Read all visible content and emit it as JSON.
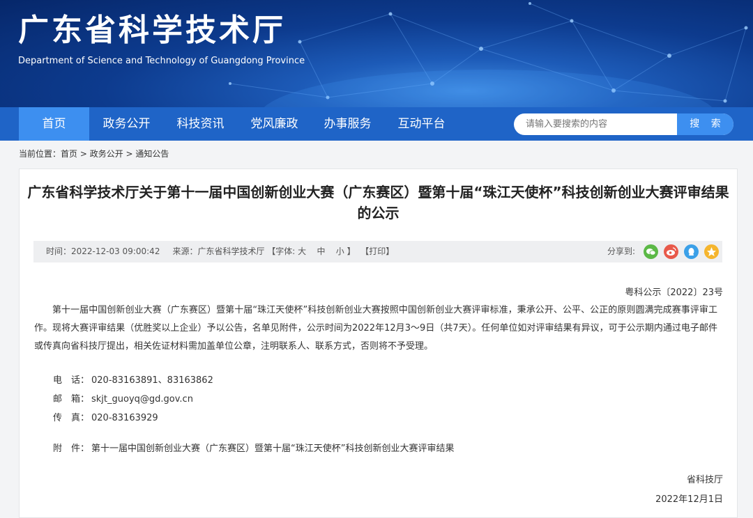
{
  "header": {
    "title": "广东省科学技术厅",
    "subtitle": "Department of Science and Technology of Guangdong Province"
  },
  "nav": {
    "items": [
      {
        "label": "首页",
        "active": true
      },
      {
        "label": "政务公开"
      },
      {
        "label": "科技资讯"
      },
      {
        "label": "党风廉政"
      },
      {
        "label": "办事服务"
      },
      {
        "label": "互动平台"
      }
    ],
    "search_placeholder": "请输入要搜索的内容",
    "search_button": "搜 索"
  },
  "breadcrumb": {
    "prefix": "当前位置：",
    "items": [
      "首页",
      "政务公开",
      "通知公告"
    ],
    "separator": " > "
  },
  "article": {
    "title": "广东省科学技术厅关于第十一届中国创新创业大赛（广东赛区）暨第十届“珠江天使杯”科技创新创业大赛评审结果的公示",
    "meta": {
      "time": "时间：2022-12-03 09:00:42",
      "source": "来源：广东省科学技术厅",
      "font_label": "【字体:",
      "font_large": "大",
      "font_medium": "中",
      "font_small": "小",
      "font_close": "】",
      "print": "【打印】",
      "share_label": "分享到:"
    },
    "share_icons": [
      "wechat-icon",
      "weibo-icon",
      "qq-icon",
      "qzone-icon"
    ],
    "doc_number": "粤科公示〔2022〕23号",
    "paragraph": "第十一届中国创新创业大赛（广东赛区）暨第十届“珠江天使杯”科技创新创业大赛按照中国创新创业大赛评审标准，秉承公开、公平、公正的原则圆满完成赛事评审工作。现将大赛评审结果（优胜奖以上企业）予以公告，名单见附件，公示时间为2022年12月3～9日（共7天）。任何单位如对评审结果有异议，可于公示期内通过电子邮件或传真向省科技厅提出，相关佐证材料需加盖单位公章，注明联系人、联系方式，否则将不予受理。",
    "contacts": [
      {
        "label": "电　话：",
        "value": "020-83163891、83163862"
      },
      {
        "label": "邮　箱：",
        "value": "skjt_guoyq@gd.gov.cn"
      },
      {
        "label": "传　真：",
        "value": "020-83163929"
      }
    ],
    "attachment": {
      "label": "附　件：",
      "value": "第十一届中国创新创业大赛（广东赛区）暨第十届“珠江天使杯”科技创新创业大赛评审结果"
    },
    "signature": "省科技厅",
    "date": "2022年12月1日"
  },
  "colors": {
    "nav_bg": "#1f64c7",
    "nav_active": "#3d8ff0",
    "share_wechat": "#5bb846",
    "share_weibo": "#e8594a",
    "share_qq": "#3ba0e8",
    "share_qzone": "#f5b52e"
  }
}
